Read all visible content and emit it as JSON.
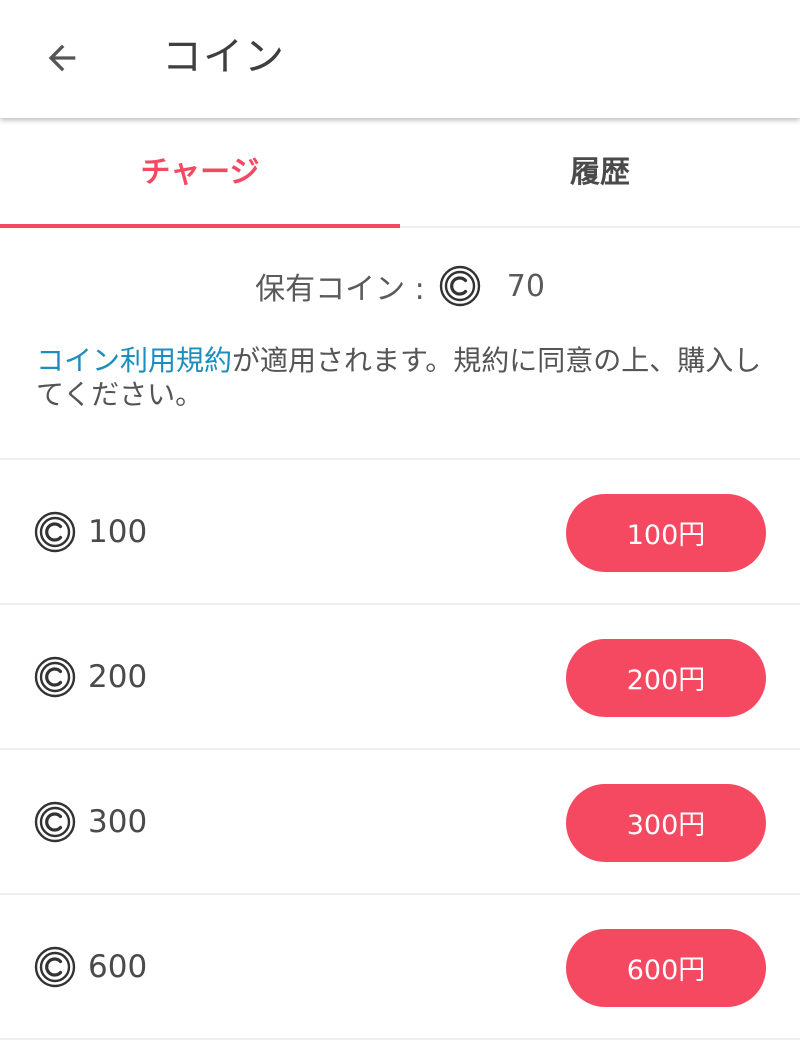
{
  "appbar": {
    "title": "コイン",
    "back_icon": "arrow-back-icon"
  },
  "tabs": [
    {
      "label": "チャージ",
      "active": true
    },
    {
      "label": "履歴",
      "active": false
    }
  ],
  "balance": {
    "label": "保有コイン :",
    "icon": "coin-icon",
    "value": "70"
  },
  "terms": {
    "link_text": "コイン利用規約",
    "text": "が適用されます。規約に同意の上、購入してください。"
  },
  "plans": [
    {
      "coins": "100",
      "price": "100円"
    },
    {
      "coins": "200",
      "price": "200円"
    },
    {
      "coins": "300",
      "price": "300円"
    },
    {
      "coins": "600",
      "price": "600円"
    }
  ],
  "colors": {
    "accent": "#f54962",
    "link": "#1a8fbf",
    "text": "#4a4a4a"
  }
}
